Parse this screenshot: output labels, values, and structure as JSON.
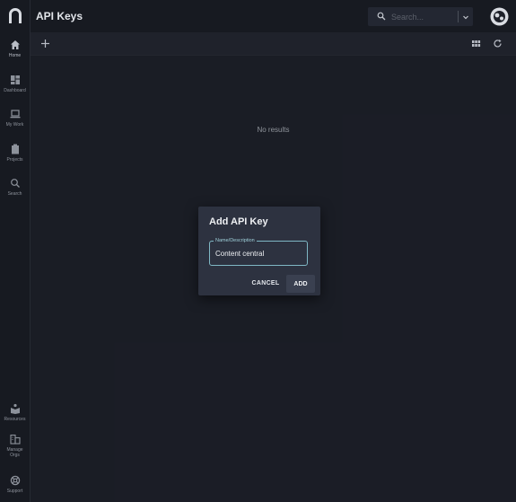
{
  "header": {
    "title": "API Keys"
  },
  "search": {
    "placeholder": "Search..."
  },
  "sidebar": {
    "items": [
      {
        "label": "Home",
        "icon": "home-icon"
      },
      {
        "label": "Dashboard",
        "icon": "dashboard-icon"
      },
      {
        "label": "My Work",
        "icon": "laptop-icon"
      },
      {
        "label": "Projects",
        "icon": "clipboard-icon"
      },
      {
        "label": "Search",
        "icon": "search-icon"
      }
    ],
    "bottom_items": [
      {
        "label": "Resources",
        "icon": "resources-icon"
      },
      {
        "label": "Manage",
        "label2": "Orgs",
        "icon": "organization-icon"
      },
      {
        "label": "Support",
        "icon": "lifebuoy-icon"
      }
    ]
  },
  "main": {
    "empty_text": "No results"
  },
  "dialog": {
    "title": "Add API Key",
    "field_label": "Name/Description",
    "field_value": "Content central",
    "cancel_label": "CANCEL",
    "add_label": "ADD"
  },
  "colors": {
    "background": "#1d2029",
    "sidebar": "#171a21",
    "dialog": "#2d3240",
    "accent": "#7fb7c4"
  }
}
